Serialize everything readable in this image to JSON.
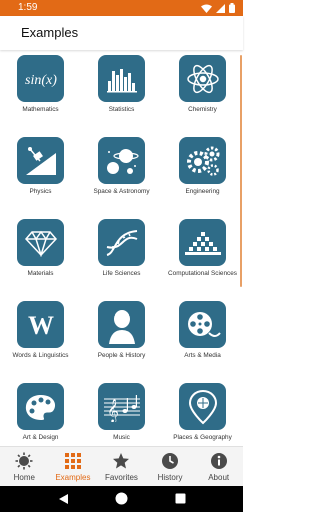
{
  "status_bar": {
    "time": "1:59"
  },
  "app_bar": {
    "title": "Examples"
  },
  "categories": [
    {
      "label": "Mathematics",
      "icon": "sin-x-icon"
    },
    {
      "label": "Statistics",
      "icon": "histogram-icon"
    },
    {
      "label": "Chemistry",
      "icon": "atom-icon"
    },
    {
      "label": "Physics",
      "icon": "physics-incline-icon"
    },
    {
      "label": "Space & Astronomy",
      "icon": "planets-icon"
    },
    {
      "label": "Engineering",
      "icon": "gears-icon"
    },
    {
      "label": "Materials",
      "icon": "diamond-icon"
    },
    {
      "label": "Life Sciences",
      "icon": "dna-icon"
    },
    {
      "label": "Computational Sciences",
      "icon": "cellular-automaton-icon"
    },
    {
      "label": "Words & Linguistics",
      "icon": "letter-w-icon"
    },
    {
      "label": "People & History",
      "icon": "washington-portrait-icon"
    },
    {
      "label": "Arts & Media",
      "icon": "film-reel-icon"
    },
    {
      "label": "Art & Design",
      "icon": "paint-palette-icon"
    },
    {
      "label": "Music",
      "icon": "music-staff-icon"
    },
    {
      "label": "Places & Geography",
      "icon": "map-pin-icon"
    }
  ],
  "bottom_nav": [
    {
      "label": "Home",
      "icon": "home-sun-icon",
      "active": false
    },
    {
      "label": "Examples",
      "icon": "grid-icon",
      "active": true
    },
    {
      "label": "Favorites",
      "icon": "star-icon",
      "active": false
    },
    {
      "label": "History",
      "icon": "clock-icon",
      "active": false
    },
    {
      "label": "About",
      "icon": "info-icon",
      "active": false
    }
  ],
  "colors": {
    "accent": "#e26a16",
    "tile": "#2f6c88"
  }
}
